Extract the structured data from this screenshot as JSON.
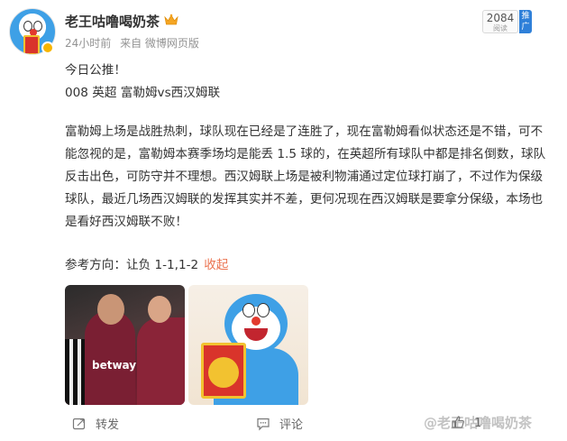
{
  "author": {
    "name": "老王咕噜喝奶茶",
    "badge_icon": "crown-icon"
  },
  "meta": {
    "time": "24小时前",
    "source": "来自 微博网页版"
  },
  "read_count": {
    "value": "2084",
    "label": "阅读"
  },
  "promo_label": "推广",
  "post": {
    "line1": "今日公推！",
    "line2": "008 英超 富勒姆vs西汉姆联",
    "paragraph": "富勒姆上场是战胜热刺，球队现在已经是了连胜了，现在富勒姆看似状态还是不错，可不能忽视的是，富勒姆本赛季场均是能丢 1.5 球的，在英超所有球队中都是排名倒数，球队反击出色，可防守并不理想。西汉姆联上场是被利物浦通过定位球打崩了，不过作为保级球队，最近几场西汉姆联的发挥其实并不差，更何况现在西汉姆联是要拿分保级，本场也是看好西汉姆联不败！",
    "reference": "参考方向：让负 1-1,1-2",
    "collapse": "收起"
  },
  "images": [
    {
      "subject": "football-players-celebrating",
      "sponsor_text": "betway"
    },
    {
      "subject": "doraemon-with-red-envelope"
    }
  ],
  "footer": {
    "share": "转发",
    "comment": "评论",
    "like_count": "1"
  },
  "watermark": "@老王咕噜喝奶茶",
  "colors": {
    "accent_link": "#eb7350",
    "meta_gray": "#939393",
    "promo_blue": "#2f80d9"
  }
}
